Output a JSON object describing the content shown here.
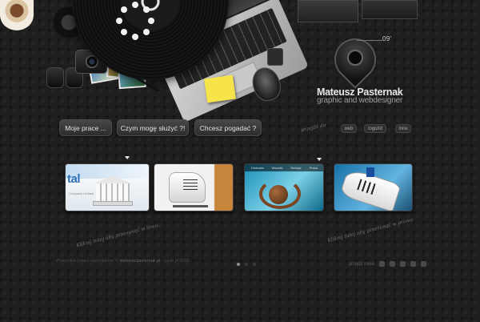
{
  "logo": {
    "name": "Mateusz Pasternak",
    "subtitle": "graphic and webdesigner",
    "year": "09'"
  },
  "nav": {
    "items": [
      {
        "label": "Moje prace ..."
      },
      {
        "label": "Czym mogę służyć ?!"
      },
      {
        "label": "Chcesz pogadać ?"
      }
    ],
    "hint": "przejdź do"
  },
  "tags": [
    "web",
    "logo/id",
    "inne"
  ],
  "gallery": {
    "thumb1": {
      "title": "tal",
      "caption": "Company Limited"
    },
    "thumb3_menu": [
      "Hodowla",
      "Wszelki",
      "Relacje",
      "Praca"
    ]
  },
  "annotations": {
    "left_note": "Kliknij tutaj aby przesunąć w lewo...",
    "right_note": "Kliknij tutaj aby przesunąć w prawo"
  },
  "footer": {
    "copyright": "Wszystkie prawa zastrzeżone ©",
    "domain": "mateuszpasternak.pl",
    "separator": "-",
    "partner": "pazb.pl 2009",
    "social_label": "znajdź mnie"
  },
  "pagination": {
    "count": 3,
    "active_index": 0
  },
  "colors": {
    "background": "#1e1e1e",
    "button": "#3a3a3a",
    "sticky_note": "#f7e44a"
  }
}
